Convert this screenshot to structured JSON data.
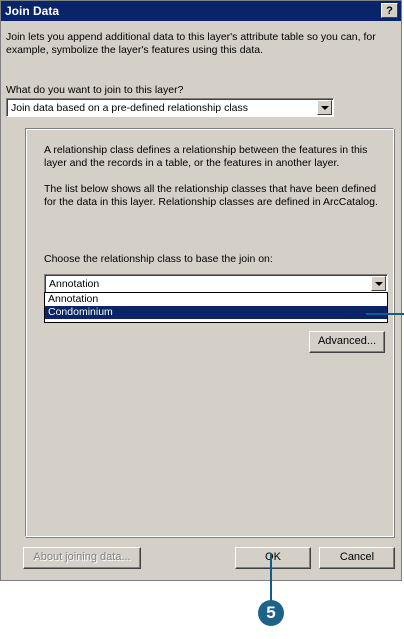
{
  "window": {
    "title": "Join Data",
    "help_label": "?"
  },
  "intro_text": "Join lets you append additional data to this layer's attribute table so you can, for example, symbolize the layer's features using this data.",
  "join_question": "What do you want to join to this layer?",
  "join_type": {
    "selected": "Join data based on a pre-defined relationship class"
  },
  "group": {
    "description1": "A relationship class defines a relationship between the features in this layer and the records in a table, or the features in another layer.",
    "description2": "The list below shows all the relationship classes that have been defined for the data in this layer. Relationship classes are defined in ArcCatalog.",
    "choose_label": "Choose the relationship class to base the join on:",
    "relationship_class": {
      "selected": "Annotation",
      "options": [
        "Annotation",
        "Condominium"
      ],
      "highlighted": "Condominium"
    },
    "advanced_label": "Advanced..."
  },
  "buttons": {
    "about": "About joining data...",
    "ok": "OK",
    "cancel": "Cancel"
  },
  "callout": {
    "step": "5",
    "color": "#1d6288"
  }
}
